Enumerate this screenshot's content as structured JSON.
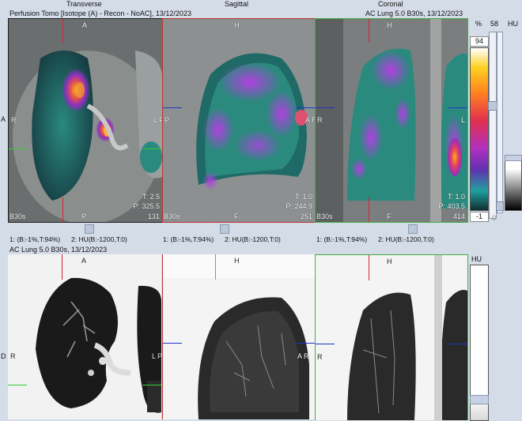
{
  "headers": {
    "transverse": "Transverse",
    "sagittal": "Sagittal",
    "coronal": "Coronal",
    "pet_series": "Perfusion Tomo [Isotope  (A) - Recon - NoAC], 13/12/2023",
    "ct_series_right": "AC  Lung  5.0  B30s, 13/12/2023",
    "ct_series_bottom": "AC  Lung  5.0  B30s, 13/12/2023"
  },
  "orient": {
    "A": "A",
    "P": "P",
    "H": "H",
    "F": "F",
    "R": "R",
    "L": "L",
    "AR": "A R",
    "LP": "L P",
    "PSide": "P"
  },
  "fused": {
    "transverse": {
      "t": "T: 2.5",
      "p": "P: 325.5",
      "slice": "131",
      "kernel": "B30s"
    },
    "sagittal": {
      "t": "T: 1.0",
      "p": "P: 244.9",
      "slice": "251",
      "kernel": "B30s"
    },
    "coronal": {
      "t": "T: 1.0",
      "p": "P: 403.5",
      "slice": "414",
      "kernel": "B30s"
    }
  },
  "window_labels": {
    "w1": "1: (B:-1%,T:94%)",
    "w2": "2: HU(B:-1200,T:0)"
  },
  "colorbar": {
    "pct_label": "%",
    "max": "94",
    "min": "-1",
    "top_value": "58",
    "hu_label": "HU",
    "zero": "0"
  },
  "ct_bottom": {
    "hu_label": "HU",
    "side_left": "D"
  },
  "colors": {
    "transverse_border": "#202020",
    "sagittal_border": "#c03030",
    "coronal_border": "#40b040",
    "background": "#d4dce8"
  }
}
